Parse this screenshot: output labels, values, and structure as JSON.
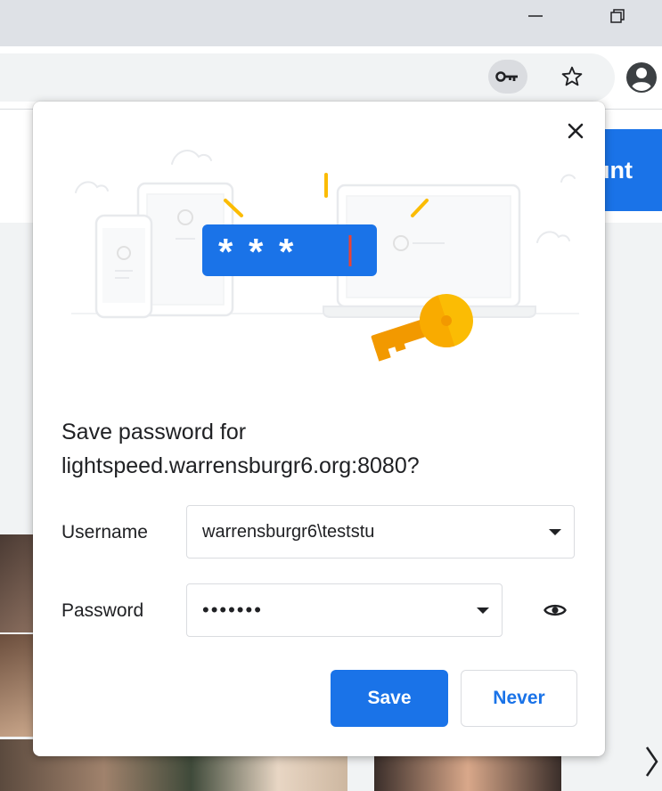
{
  "dialog": {
    "title_line1": "Save password for",
    "title_line2": "lightspeed.warrensburgr6.org:8080?",
    "username_label": "Username",
    "username_value": "warrensburgr6\\teststu",
    "password_label": "Password",
    "password_value": "•••••••",
    "save_label": "Save",
    "never_label": "Never",
    "illustration_text": "* * *"
  },
  "page": {
    "button_partial_label": "unt"
  },
  "icons": {
    "key": "key-icon",
    "star": "star-icon",
    "profile": "account-circle-icon",
    "close": "close-icon",
    "eye": "eye-icon",
    "chevron": "chevron-right-icon"
  },
  "colors": {
    "accent": "#1a73e8",
    "illustration_yellow": "#fbbc04",
    "cursor_red": "#ea4335"
  }
}
